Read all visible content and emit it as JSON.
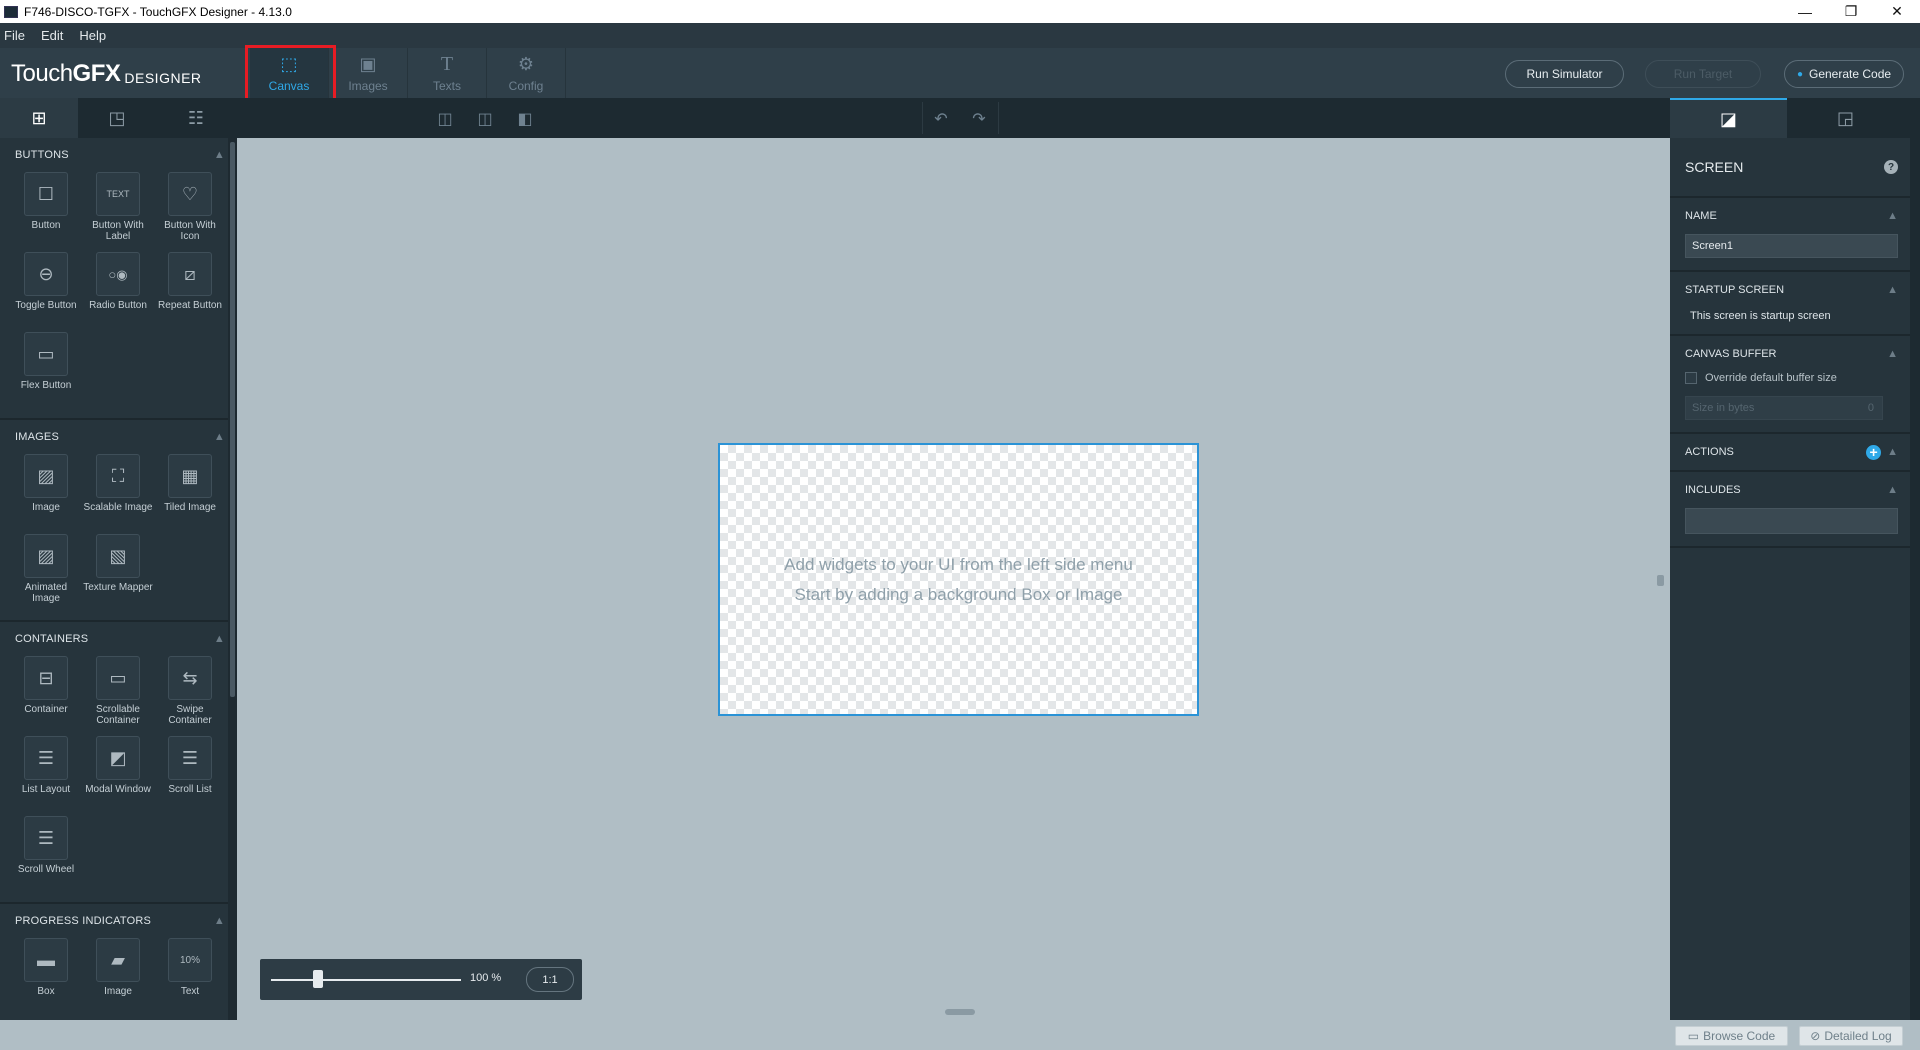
{
  "window": {
    "title": "F746-DISCO-TGFX - TouchGFX Designer - 4.13.0",
    "minimize": "—",
    "maximize": "❐",
    "close": "✕"
  },
  "menu": [
    "File",
    "Edit",
    "Help"
  ],
  "logo": {
    "part1": "Touch",
    "part2": "GFX",
    "part3": "DESIGNER"
  },
  "nav_tabs": [
    {
      "label": "Canvas",
      "icon": "canvas-icon",
      "active": true
    },
    {
      "label": "Images",
      "icon": "images-icon",
      "active": false
    },
    {
      "label": "Texts",
      "icon": "texts-icon",
      "active": false
    },
    {
      "label": "Config",
      "icon": "config-icon",
      "active": false
    }
  ],
  "toolbar_buttons": {
    "run_simulator": "Run Simulator",
    "run_target": "Run Target",
    "generate_code": "Generate Code"
  },
  "sidebar": {
    "sections": [
      {
        "title": "BUTTONS",
        "items": [
          "Button",
          "Button With Label",
          "Button With Icon",
          "Toggle Button",
          "Radio Button",
          "Repeat Button",
          "Flex Button"
        ]
      },
      {
        "title": "IMAGES",
        "items": [
          "Image",
          "Scalable Image",
          "Tiled Image",
          "Animated Image",
          "Texture Mapper"
        ]
      },
      {
        "title": "CONTAINERS",
        "items": [
          "Container",
          "Scrollable Container",
          "Swipe Container",
          "List Layout",
          "Modal Window",
          "Scroll List",
          "Scroll Wheel"
        ]
      },
      {
        "title": "PROGRESS INDICATORS",
        "items": [
          "Box",
          "Image",
          "Text"
        ]
      }
    ]
  },
  "canvas": {
    "hint_line1": "Add widgets to your UI from the left side menu",
    "hint_line2": "Start by adding a background Box or Image",
    "zoom_percent": 100,
    "zoom_label": "100 %",
    "zoom_reset": "1:1"
  },
  "properties": {
    "title": "SCREEN",
    "help": "?",
    "name_header": "NAME",
    "name_value": "Screen1",
    "startup_header": "STARTUP SCREEN",
    "startup_text": "This screen is startup screen",
    "canvas_buffer_header": "CANVAS BUFFER",
    "override_label": "Override default buffer size",
    "size_placeholder": "Size in bytes",
    "size_value": "0",
    "actions_header": "ACTIONS",
    "includes_header": "INCLUDES"
  },
  "status": {
    "browse_code": "Browse Code",
    "detailed_log": "Detailed Log"
  },
  "colors": {
    "accent": "#2fa9e8",
    "highlight": "#e81c24",
    "canvas_bg": "#b0bec5",
    "panel_bg": "#26343c"
  }
}
